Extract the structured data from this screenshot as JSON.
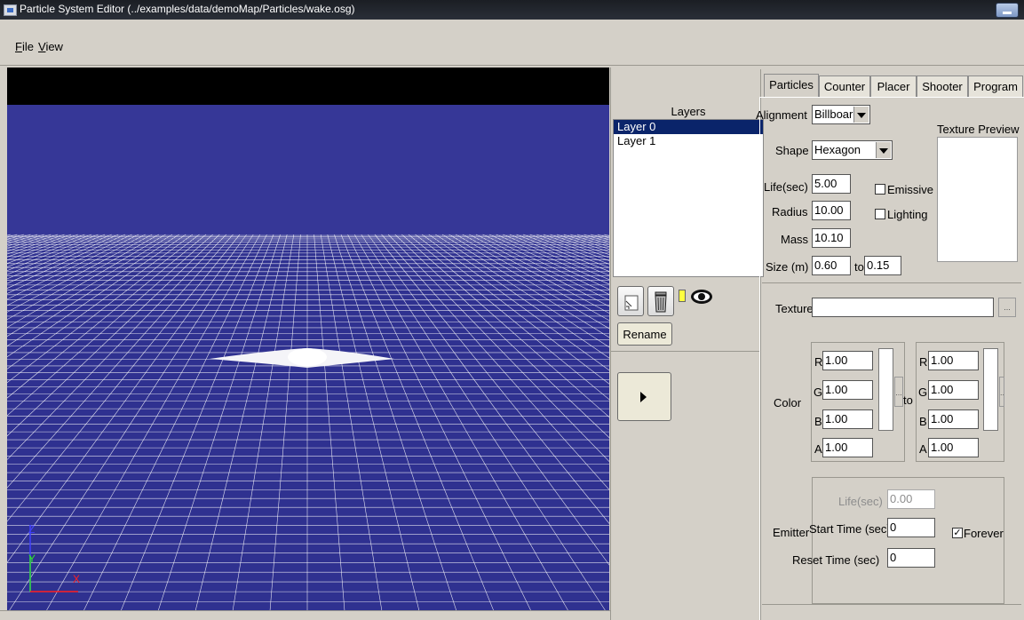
{
  "window": {
    "title": "Particle System Editor (../examples/data/demoMap/Particles/wake.osg)"
  },
  "menu": {
    "file": "File",
    "view": "View"
  },
  "colors": {
    "viewport_sky": "#363797",
    "viewport_ground": "#2f3190",
    "grid_line": "#ffffff",
    "axis_x": "#ff2020",
    "axis_y": "#30e030",
    "axis_z": "#4040ff",
    "selection": "#0a246a"
  },
  "viewport": {
    "axis_x": "X",
    "axis_y": "Y",
    "axis_z": "Z"
  },
  "layers": {
    "title": "Layers",
    "items": [
      "Layer 0",
      "Layer 1"
    ],
    "selected": 0,
    "rename_label": "Rename",
    "icons": [
      "new-layer-icon",
      "trash-icon",
      "visibility-eye-icon"
    ]
  },
  "tabs": [
    "Particles",
    "Counter",
    "Placer",
    "Shooter",
    "Program"
  ],
  "particles": {
    "alignment_label": "Alignment",
    "alignment_value": "Billboard",
    "shape_label": "Shape",
    "shape_value": "Hexagon",
    "texture_preview_label": "Texture Preview",
    "life_label": "Life(sec)",
    "life_value": "5.00",
    "radius_label": "Radius",
    "radius_value": "10.00",
    "mass_label": "Mass",
    "mass_value": "10.10",
    "size_label": "Size (m)",
    "size_from": "0.60",
    "size_to_label": "to",
    "size_to": "0.15",
    "emissive_label": "Emissive",
    "emissive_checked": false,
    "lighting_label": "Lighting",
    "lighting_checked": false,
    "texture_label": "Texture",
    "texture_value": "",
    "browse_label": "...",
    "color_label": "Color",
    "color_to_label": "to",
    "color_from": {
      "R": "1.00",
      "G": "1.00",
      "B": "1.00",
      "A": "1.00"
    },
    "color_to": {
      "R": "1.00",
      "G": "1.00",
      "B": "1.00",
      "A": "1.00"
    },
    "channel_labels": [
      "R",
      "G",
      "B",
      "A"
    ],
    "picker_label": "...",
    "emitter_label": "Emitter",
    "emitter_life_label": "Life(sec)",
    "emitter_life_value": "0.00",
    "start_time_label": "Start Time (sec)",
    "start_time_value": "0",
    "reset_time_label": "Reset Time (sec)",
    "reset_time_value": "0",
    "forever_label": "Forever",
    "forever_checked": true
  }
}
